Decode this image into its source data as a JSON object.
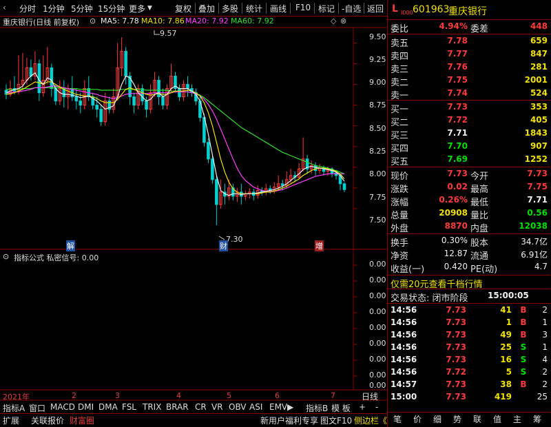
{
  "toolbar": {
    "items": [
      "分时",
      "1分钟",
      "5分钟",
      "15分钟",
      "更多",
      "复权",
      "叠加",
      "多股",
      "统计",
      "画线",
      "F10",
      "标记",
      "-自选",
      "返回"
    ]
  },
  "chart_header": {
    "stock_title": "重庆银行(日线 前复权)",
    "ma5": "MA5: 7.78",
    "ma10": "MA10: 7.86",
    "ma20": "MA20: 7.92",
    "ma60": "MA60: 7.92"
  },
  "price_axis": [
    "9.50",
    "9.25",
    "9.00",
    "8.75",
    "8.50",
    "8.25",
    "8.00",
    "7.75",
    "7.50"
  ],
  "indicator_axis": [
    "0.00",
    "0.00",
    "0.00",
    "0.00",
    "0.00",
    "0.00",
    "0.00",
    "0.00",
    "0.00"
  ],
  "annotations": {
    "high": "9.57",
    "low": "7.30",
    "marker_jie": "解",
    "marker_cai": "财",
    "marker_zeng": "增"
  },
  "indicator_header": "指标公式 私密信号: 0.00",
  "date_axis": {
    "year": "2021年",
    "months": [
      "2",
      "3",
      "4",
      "5",
      "6",
      "7"
    ],
    "period": "日线"
  },
  "bottom_tabs": [
    "指标A",
    "窗口",
    "MACD",
    "DMI",
    "DMA",
    "FSL",
    "TRIX",
    "BRAR",
    "CR",
    "VR",
    "OBV",
    "ASI",
    "EMV",
    "指标B",
    "模 板",
    "+",
    "-"
  ],
  "status_tabs": {
    "left": [
      "扩展",
      "关联报价",
      "财富圈"
    ],
    "promo": "新用户福利专享",
    "right_btns": [
      "图文F10",
      "侧边栏《"
    ]
  },
  "chart_data": {
    "type": "candlestick",
    "title": "重庆银行(日线 前复权)",
    "y_range": [
      7.3,
      9.57
    ],
    "series_names": [
      "MA5",
      "MA10",
      "MA20",
      "MA60"
    ],
    "colors": {
      "up": "#ff3b3b",
      "down": "#00d0d0",
      "ma5": "#f0f0f0",
      "ma10": "#f0e000",
      "ma20": "#ff40ff",
      "ma60": "#30e030"
    },
    "candles": [
      {
        "o": 8.93,
        "c": 8.88,
        "h": 9.0,
        "l": 8.82
      },
      {
        "o": 8.88,
        "c": 8.95,
        "h": 9.05,
        "l": 8.85
      },
      {
        "o": 8.95,
        "c": 8.92,
        "h": 9.1,
        "l": 8.88
      },
      {
        "o": 8.92,
        "c": 9.0,
        "h": 9.35,
        "l": 8.88
      },
      {
        "o": 9.0,
        "c": 9.05,
        "h": 9.38,
        "l": 8.95
      },
      {
        "o": 9.05,
        "c": 9.2,
        "h": 9.32,
        "l": 9.0
      },
      {
        "o": 9.2,
        "c": 9.1,
        "h": 9.3,
        "l": 9.05
      },
      {
        "o": 9.1,
        "c": 9.25,
        "h": 9.4,
        "l": 9.05
      },
      {
        "o": 9.25,
        "c": 8.9,
        "h": 9.3,
        "l": 8.8
      },
      {
        "o": 8.9,
        "c": 9.05,
        "h": 9.35,
        "l": 8.85
      },
      {
        "o": 9.05,
        "c": 9.2,
        "h": 9.45,
        "l": 9.0
      },
      {
        "o": 9.2,
        "c": 8.95,
        "h": 9.25,
        "l": 8.85
      },
      {
        "o": 8.95,
        "c": 8.8,
        "h": 9.0,
        "l": 8.75
      },
      {
        "o": 8.8,
        "c": 8.95,
        "h": 9.05,
        "l": 8.75
      },
      {
        "o": 8.95,
        "c": 8.85,
        "h": 9.05,
        "l": 8.72
      },
      {
        "o": 8.85,
        "c": 8.95,
        "h": 9.0,
        "l": 8.7
      },
      {
        "o": 8.95,
        "c": 8.85,
        "h": 9.1,
        "l": 8.8
      },
      {
        "o": 8.85,
        "c": 8.8,
        "h": 8.95,
        "l": 8.7
      },
      {
        "o": 8.8,
        "c": 8.75,
        "h": 8.9,
        "l": 8.65
      },
      {
        "o": 8.75,
        "c": 8.95,
        "h": 9.05,
        "l": 8.7
      },
      {
        "o": 8.95,
        "c": 8.85,
        "h": 9.1,
        "l": 8.8
      },
      {
        "o": 8.85,
        "c": 8.75,
        "h": 8.9,
        "l": 8.7
      },
      {
        "o": 8.75,
        "c": 8.7,
        "h": 8.85,
        "l": 8.6
      },
      {
        "o": 8.7,
        "c": 8.55,
        "h": 8.75,
        "l": 8.5
      },
      {
        "o": 8.55,
        "c": 8.8,
        "h": 8.9,
        "l": 8.5
      },
      {
        "o": 8.8,
        "c": 8.7,
        "h": 8.85,
        "l": 8.65
      },
      {
        "o": 8.7,
        "c": 8.85,
        "h": 8.95,
        "l": 8.65
      },
      {
        "o": 8.85,
        "c": 9.2,
        "h": 9.5,
        "l": 8.8
      },
      {
        "o": 9.2,
        "c": 9.4,
        "h": 9.57,
        "l": 9.1
      },
      {
        "o": 9.4,
        "c": 9.1,
        "h": 9.45,
        "l": 9.0
      },
      {
        "o": 9.1,
        "c": 8.85,
        "h": 9.15,
        "l": 8.75
      },
      {
        "o": 8.85,
        "c": 8.75,
        "h": 8.9,
        "l": 8.65
      },
      {
        "o": 8.75,
        "c": 8.95,
        "h": 9.0,
        "l": 8.7
      },
      {
        "o": 8.95,
        "c": 8.8,
        "h": 9.0,
        "l": 8.75
      },
      {
        "o": 8.8,
        "c": 8.7,
        "h": 8.85,
        "l": 8.6
      },
      {
        "o": 8.7,
        "c": 8.9,
        "h": 9.0,
        "l": 8.65
      },
      {
        "o": 8.9,
        "c": 9.05,
        "h": 9.15,
        "l": 8.85
      },
      {
        "o": 9.05,
        "c": 8.85,
        "h": 9.1,
        "l": 8.75
      },
      {
        "o": 8.85,
        "c": 8.75,
        "h": 8.95,
        "l": 8.7
      },
      {
        "o": 8.75,
        "c": 8.95,
        "h": 9.0,
        "l": 8.7
      },
      {
        "o": 8.95,
        "c": 9.1,
        "h": 9.25,
        "l": 8.9
      },
      {
        "o": 9.1,
        "c": 8.95,
        "h": 9.15,
        "l": 8.9
      },
      {
        "o": 8.95,
        "c": 8.85,
        "h": 9.0,
        "l": 8.8
      },
      {
        "o": 8.85,
        "c": 9.0,
        "h": 9.05,
        "l": 8.8
      },
      {
        "o": 9.0,
        "c": 8.95,
        "h": 9.1,
        "l": 8.85
      },
      {
        "o": 8.95,
        "c": 8.9,
        "h": 9.0,
        "l": 8.85
      },
      {
        "o": 8.9,
        "c": 8.8,
        "h": 8.95,
        "l": 8.75
      },
      {
        "o": 8.8,
        "c": 8.6,
        "h": 8.85,
        "l": 8.55
      },
      {
        "o": 8.6,
        "c": 8.3,
        "h": 8.65,
        "l": 8.25
      },
      {
        "o": 8.3,
        "c": 8.1,
        "h": 8.35,
        "l": 8.05
      },
      {
        "o": 8.1,
        "c": 7.85,
        "h": 8.15,
        "l": 7.8
      },
      {
        "o": 7.85,
        "c": 7.55,
        "h": 7.9,
        "l": 7.3
      },
      {
        "o": 7.55,
        "c": 7.7,
        "h": 7.85,
        "l": 7.5
      },
      {
        "o": 7.7,
        "c": 7.65,
        "h": 7.8,
        "l": 7.55
      },
      {
        "o": 7.65,
        "c": 7.75,
        "h": 7.85,
        "l": 7.6
      },
      {
        "o": 7.75,
        "c": 7.65,
        "h": 7.8,
        "l": 7.6
      },
      {
        "o": 7.65,
        "c": 7.7,
        "h": 7.75,
        "l": 7.58
      },
      {
        "o": 7.7,
        "c": 7.65,
        "h": 7.8,
        "l": 7.55
      },
      {
        "o": 7.65,
        "c": 7.68,
        "h": 7.72,
        "l": 7.6
      },
      {
        "o": 7.68,
        "c": 7.7,
        "h": 7.75,
        "l": 7.62
      },
      {
        "o": 7.7,
        "c": 7.66,
        "h": 7.74,
        "l": 7.6
      },
      {
        "o": 7.66,
        "c": 7.72,
        "h": 7.78,
        "l": 7.62
      },
      {
        "o": 7.72,
        "c": 7.7,
        "h": 7.76,
        "l": 7.66
      },
      {
        "o": 7.7,
        "c": 7.74,
        "h": 7.8,
        "l": 7.66
      },
      {
        "o": 7.74,
        "c": 7.72,
        "h": 7.78,
        "l": 7.68
      },
      {
        "o": 7.72,
        "c": 7.76,
        "h": 7.82,
        "l": 7.68
      },
      {
        "o": 7.76,
        "c": 7.8,
        "h": 7.9,
        "l": 7.72
      },
      {
        "o": 7.8,
        "c": 7.78,
        "h": 7.85,
        "l": 7.72
      },
      {
        "o": 7.78,
        "c": 7.85,
        "h": 7.95,
        "l": 7.75
      },
      {
        "o": 7.85,
        "c": 7.9,
        "h": 7.98,
        "l": 7.8
      },
      {
        "o": 7.9,
        "c": 7.88,
        "h": 7.95,
        "l": 7.82
      },
      {
        "o": 7.88,
        "c": 7.98,
        "h": 8.05,
        "l": 7.85
      },
      {
        "o": 7.98,
        "c": 8.1,
        "h": 8.36,
        "l": 7.95
      },
      {
        "o": 8.1,
        "c": 7.98,
        "h": 8.15,
        "l": 7.92
      },
      {
        "o": 7.98,
        "c": 8.02,
        "h": 8.08,
        "l": 7.92
      },
      {
        "o": 8.02,
        "c": 7.96,
        "h": 8.06,
        "l": 7.9
      },
      {
        "o": 7.96,
        "c": 7.99,
        "h": 8.04,
        "l": 7.92
      },
      {
        "o": 7.99,
        "c": 7.95,
        "h": 8.02,
        "l": 7.9
      },
      {
        "o": 7.95,
        "c": 7.98,
        "h": 8.01,
        "l": 7.9
      },
      {
        "o": 7.98,
        "c": 7.93,
        "h": 8.0,
        "l": 7.88
      },
      {
        "o": 7.93,
        "c": 7.9,
        "h": 7.96,
        "l": 7.85
      },
      {
        "o": 7.9,
        "c": 7.8,
        "h": 7.92,
        "l": 7.72
      },
      {
        "o": 7.8,
        "c": 7.73,
        "h": 7.82,
        "l": 7.7
      }
    ],
    "ma5": [
      8.9,
      8.92,
      8.94,
      8.95,
      8.98,
      9.05,
      9.1,
      9.14,
      9.05,
      9.0,
      9.08,
      9.05,
      8.95,
      8.9,
      8.88,
      8.88,
      8.87,
      8.86,
      8.84,
      8.85,
      8.86,
      8.83,
      8.8,
      8.75,
      8.7,
      8.72,
      8.74,
      8.85,
      9.0,
      9.1,
      9.08,
      9.0,
      8.9,
      8.85,
      8.8,
      8.82,
      8.88,
      8.9,
      8.85,
      8.88,
      8.95,
      8.98,
      8.95,
      8.95,
      8.95,
      8.92,
      8.88,
      8.8,
      8.62,
      8.4,
      8.15,
      7.9,
      7.72,
      7.68,
      7.66,
      7.68,
      7.68,
      7.67,
      7.68,
      7.68,
      7.68,
      7.69,
      7.7,
      7.71,
      7.72,
      7.73,
      7.75,
      7.77,
      7.8,
      7.84,
      7.88,
      7.92,
      7.97,
      8.0,
      8.01,
      8.0,
      7.99,
      7.98,
      7.97,
      7.96,
      7.94,
      7.9,
      7.83
    ],
    "ma10": [
      8.88,
      8.89,
      8.9,
      8.92,
      8.94,
      8.97,
      9.0,
      9.03,
      9.02,
      9.0,
      9.03,
      9.03,
      9.0,
      8.97,
      8.94,
      8.92,
      8.9,
      8.88,
      8.87,
      8.86,
      8.86,
      8.85,
      8.83,
      8.8,
      8.78,
      8.78,
      8.78,
      8.82,
      8.88,
      8.94,
      8.96,
      8.94,
      8.92,
      8.9,
      8.88,
      8.87,
      8.88,
      8.89,
      8.88,
      8.88,
      8.9,
      8.92,
      8.92,
      8.92,
      8.93,
      8.92,
      8.9,
      8.86,
      8.78,
      8.66,
      8.5,
      8.3,
      8.1,
      7.94,
      7.82,
      7.74,
      7.7,
      7.68,
      7.68,
      7.68,
      7.68,
      7.68,
      7.69,
      7.7,
      7.7,
      7.71,
      7.73,
      7.75,
      7.77,
      7.8,
      7.83,
      7.86,
      7.9,
      7.93,
      7.96,
      7.98,
      7.99,
      7.99,
      7.98,
      7.97,
      7.95,
      7.92,
      7.86
    ],
    "ma20": [
      8.9,
      8.9,
      8.91,
      8.91,
      8.92,
      8.93,
      8.94,
      8.96,
      8.96,
      8.96,
      8.97,
      8.98,
      8.98,
      8.97,
      8.96,
      8.95,
      8.94,
      8.93,
      8.92,
      8.91,
      8.9,
      8.89,
      8.88,
      8.86,
      8.85,
      8.84,
      8.83,
      8.84,
      8.86,
      8.88,
      8.89,
      8.89,
      8.89,
      8.89,
      8.89,
      8.89,
      8.9,
      8.9,
      8.9,
      8.9,
      8.9,
      8.91,
      8.91,
      8.91,
      8.91,
      8.9,
      8.89,
      8.86,
      8.82,
      8.76,
      8.68,
      8.58,
      8.46,
      8.34,
      8.22,
      8.1,
      7.99,
      7.9,
      7.84,
      7.8,
      7.76,
      7.74,
      7.72,
      7.71,
      7.71,
      7.71,
      7.72,
      7.73,
      7.75,
      7.77,
      7.79,
      7.81,
      7.83,
      7.85,
      7.87,
      7.89,
      7.9,
      7.91,
      7.92,
      7.92,
      7.92,
      7.92,
      7.92
    ],
    "ma60": [
      8.94,
      8.94,
      8.94,
      8.94,
      8.95,
      8.95,
      8.95,
      8.96,
      8.96,
      8.96,
      8.96,
      8.96,
      8.96,
      8.96,
      8.95,
      8.95,
      8.95,
      8.95,
      8.94,
      8.94,
      8.94,
      8.94,
      8.94,
      8.93,
      8.93,
      8.93,
      8.93,
      8.93,
      8.94,
      8.94,
      8.94,
      8.94,
      8.94,
      8.94,
      8.93,
      8.93,
      8.93,
      8.93,
      8.93,
      8.93,
      8.92,
      8.92,
      8.92,
      8.91,
      8.91,
      8.9,
      8.89,
      8.87,
      8.84,
      8.8,
      8.76,
      8.72,
      8.68,
      8.64,
      8.6,
      8.56,
      8.52,
      8.48,
      8.45,
      8.42,
      8.39,
      8.36,
      8.33,
      8.3,
      8.27,
      8.24,
      8.21,
      8.18,
      8.16,
      8.14,
      8.12,
      8.1,
      8.08,
      8.06,
      8.04,
      8.02,
      8.01,
      8.0,
      7.99,
      7.97,
      7.96,
      7.94,
      7.92
    ]
  },
  "quote": {
    "market_flag": "L",
    "level": "I000",
    "code": "601963",
    "name": "重庆银行",
    "weibi_label": "委比",
    "weibi": "4.94%",
    "weicha_label": "委差",
    "weicha": "448",
    "asks": [
      {
        "label": "卖五",
        "price": "7.78",
        "vol": "659"
      },
      {
        "label": "卖四",
        "price": "7.77",
        "vol": "847"
      },
      {
        "label": "卖三",
        "price": "7.76",
        "vol": "281"
      },
      {
        "label": "卖二",
        "price": "7.75",
        "vol": "2001"
      },
      {
        "label": "卖一",
        "price": "7.74",
        "vol": "524"
      }
    ],
    "bids": [
      {
        "label": "买一",
        "price": "7.73",
        "vol": "353"
      },
      {
        "label": "买二",
        "price": "7.72",
        "vol": "405"
      },
      {
        "label": "买三",
        "price": "7.71",
        "vol": "1843"
      },
      {
        "label": "买四",
        "price": "7.70",
        "vol": "907"
      },
      {
        "label": "买五",
        "price": "7.69",
        "vol": "1252"
      }
    ],
    "stats": [
      {
        "l1": "现价",
        "v1": "7.73",
        "l2": "今开",
        "v2": "7.73"
      },
      {
        "l1": "涨跌",
        "v1": "0.02",
        "l2": "最高",
        "v2": "7.75"
      },
      {
        "l1": "涨幅",
        "v1": "0.26%",
        "l2": "最低",
        "v2": "7.71"
      },
      {
        "l1": "总量",
        "v1": "20908",
        "l2": "量比",
        "v2": "0.56"
      },
      {
        "l1": "外盘",
        "v1": "8870",
        "l2": "内盘",
        "v2": "12038"
      }
    ],
    "fund": [
      {
        "l1": "换手",
        "v1": "0.30%",
        "l2": "股本",
        "v2": "34.7亿"
      },
      {
        "l1": "净资",
        "v1": "12.87",
        "l2": "流通",
        "v2": "6.91亿"
      },
      {
        "l1": "收益(一)",
        "v1": "0.420",
        "l2": "PE(动)",
        "v2": "4.7"
      }
    ],
    "promo": "仅需20元查看千档行情",
    "trade_state_label": "交易状态: 闭市阶段",
    "trade_state_time": "15:00:05"
  },
  "ticks": [
    {
      "t": "14:56",
      "p": "7.73",
      "v": "41",
      "d": "B",
      "n": "2"
    },
    {
      "t": "14:56",
      "p": "7.73",
      "v": "1",
      "d": "B",
      "n": "1"
    },
    {
      "t": "14:56",
      "p": "7.73",
      "v": "49",
      "d": "B",
      "n": "3"
    },
    {
      "t": "14:56",
      "p": "7.73",
      "v": "25",
      "d": "S",
      "n": "1"
    },
    {
      "t": "14:56",
      "p": "7.73",
      "v": "16",
      "d": "S",
      "n": "4"
    },
    {
      "t": "14:56",
      "p": "7.72",
      "v": "5",
      "d": "S",
      "n": "2"
    },
    {
      "t": "14:57",
      "p": "7.73",
      "v": "38",
      "d": "B",
      "n": "2"
    },
    {
      "t": "15:00",
      "p": "7.73",
      "v": "419",
      "d": "",
      "n": "25"
    }
  ],
  "side_tabs": [
    "笔",
    "价",
    "细",
    "势",
    "联",
    "值",
    "主",
    "筹"
  ]
}
